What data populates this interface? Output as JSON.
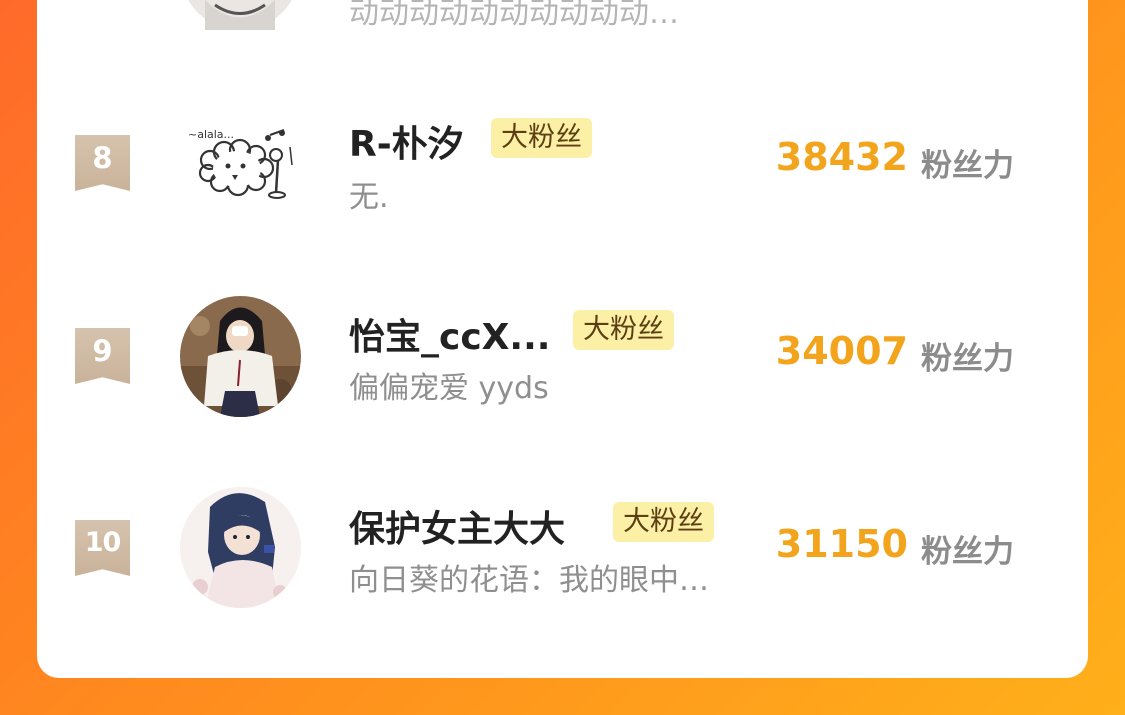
{
  "previous_row": {
    "signature": "动动动动动动动动动动…"
  },
  "ranking": [
    {
      "rank": "8",
      "name": "R-朴汐",
      "badge": "大粉丝",
      "signature": "无.",
      "score": "38432",
      "score_unit": "粉丝力",
      "avatar_icon": "cartoon-sheep-avatar"
    },
    {
      "rank": "9",
      "name": "怡宝_ccX...",
      "badge": "大粉丝",
      "signature": "偏偏宠爱 yyds",
      "score": "34007",
      "score_unit": "粉丝力",
      "avatar_icon": "girl-photo-avatar"
    },
    {
      "rank": "10",
      "name": "保护女主大大",
      "badge": "大粉丝",
      "signature": "向日葵的花语：我的眼中…",
      "score": "31150",
      "score_unit": "粉丝力",
      "avatar_icon": "anime-girl-avatar"
    }
  ],
  "colors": {
    "background_start": "#ff6a2a",
    "background_end": "#ffb01a",
    "score": "#f3a41d",
    "badge_bg": "#fcefa6",
    "rank_flag": "#d6c3ad"
  }
}
